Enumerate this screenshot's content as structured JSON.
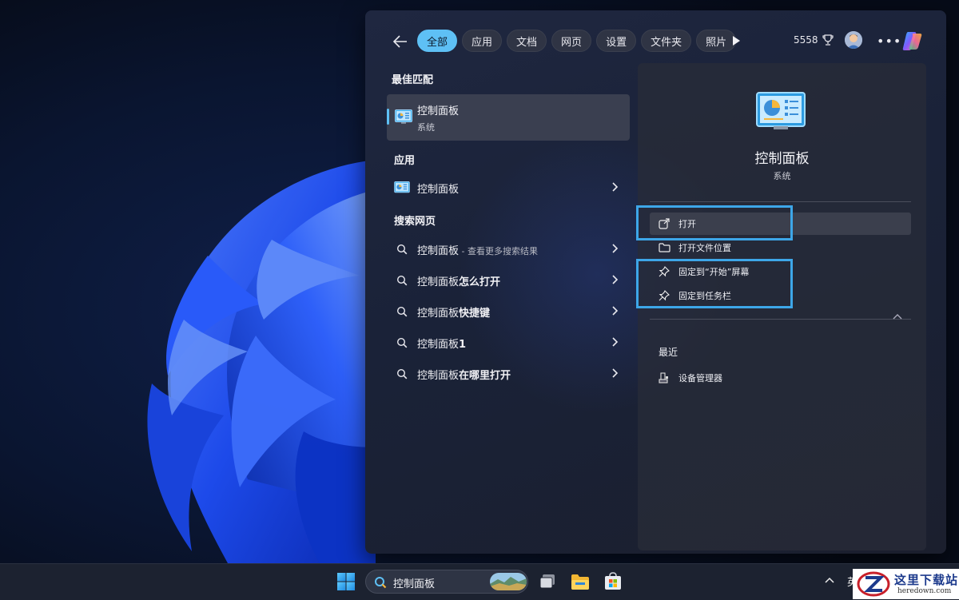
{
  "search_panel": {
    "tabs": [
      "全部",
      "应用",
      "文档",
      "网页",
      "设置",
      "文件夹",
      "照片"
    ],
    "active_tab": "全部",
    "points": "5558",
    "icons": {
      "back": "arrow-left-icon",
      "play": "play-icon",
      "points": "trophy-icon",
      "more": "more-horizontal-icon",
      "copilot": "copilot-icon"
    },
    "best_match": {
      "heading": "最佳匹配",
      "name": "控制面板",
      "type": "系统",
      "icon": "control-panel-icon"
    },
    "apps": {
      "heading": "应用",
      "items": [
        {
          "label": "控制面板",
          "icon": "control-panel-icon"
        }
      ]
    },
    "web": {
      "heading": "搜索网页",
      "items": [
        {
          "label": "控制面板",
          "suffix": " - 查看更多搜索结果",
          "bold": ""
        },
        {
          "label": "控制面板",
          "suffix": "",
          "bold": "怎么打开"
        },
        {
          "label": "控制面板",
          "suffix": "",
          "bold": "快捷键"
        },
        {
          "label": "控制面板",
          "suffix": "",
          "bold": "1"
        },
        {
          "label": "控制面板",
          "suffix": "",
          "bold": "在哪里打开"
        }
      ]
    },
    "preview": {
      "title": "控制面板",
      "subtitle": "系统",
      "actions": [
        {
          "label": "打开",
          "icon": "open-external-icon"
        },
        {
          "label": "打开文件位置",
          "icon": "folder-icon"
        },
        {
          "label": "固定到“开始”屏幕",
          "icon": "pin-icon"
        },
        {
          "label": "固定到任务栏",
          "icon": "pin-icon"
        }
      ],
      "recent_heading": "最近",
      "recent_items": [
        {
          "label": "设备管理器",
          "icon": "device-manager-icon"
        }
      ]
    }
  },
  "taskbar": {
    "search_text": "控制面板",
    "apps": [
      "task-view-icon",
      "file-explorer-icon",
      "microsoft-store-icon"
    ],
    "tray_language": "英"
  },
  "watermark": {
    "text": "这里下载站",
    "url": "heredown.com"
  },
  "colors": {
    "accent": "#5ec0f5",
    "highlight_border": "#3da6e8",
    "panel_bg": "#1f2535"
  }
}
